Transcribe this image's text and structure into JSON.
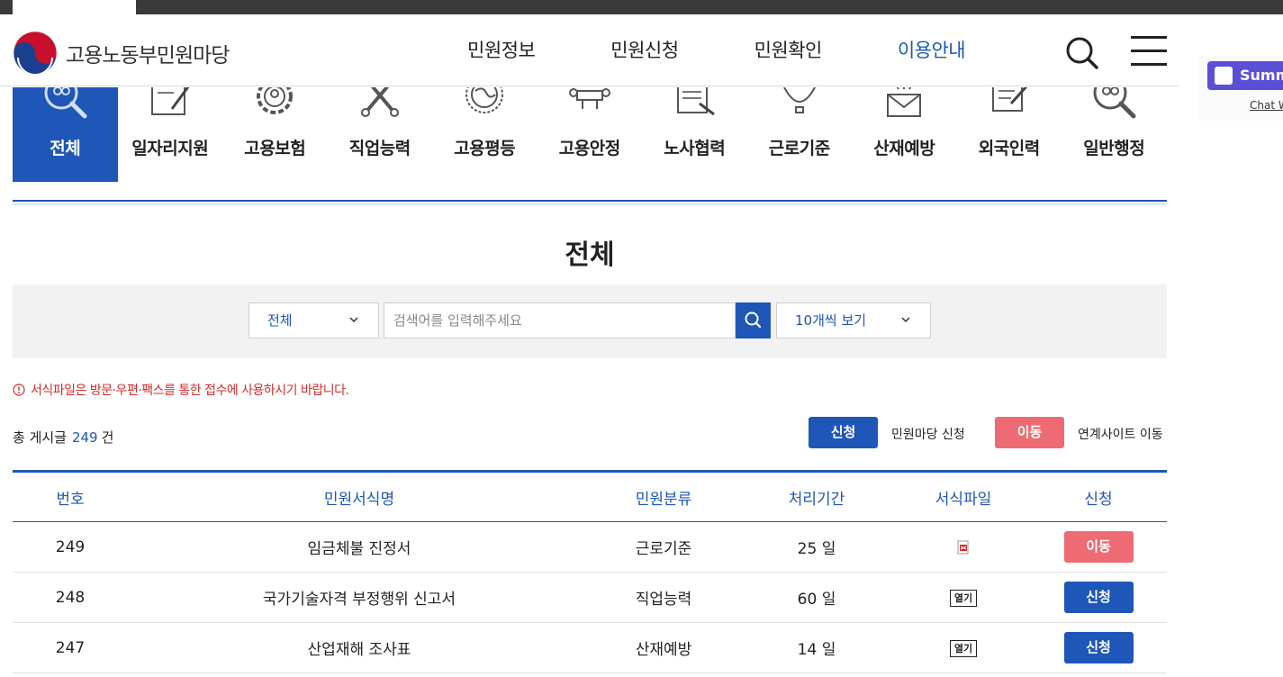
{
  "header": {
    "logo_text": "고용노동부민원마당",
    "nav": [
      {
        "label": "민원정보",
        "active": false
      },
      {
        "label": "민원신청",
        "active": false
      },
      {
        "label": "민원확인",
        "active": false
      },
      {
        "label": "이용안내",
        "active": true
      }
    ],
    "icons": {
      "search": "search-icon",
      "menu": "hamburger-menu-icon"
    }
  },
  "categories": [
    {
      "label": "전체",
      "icon": "magnifier-people-icon",
      "active": true
    },
    {
      "label": "일자리지원",
      "icon": "document-pen-icon",
      "active": false
    },
    {
      "label": "고용보험",
      "icon": "gear-people-icon",
      "active": false
    },
    {
      "label": "직업능력",
      "icon": "tools-icon",
      "active": false
    },
    {
      "label": "고용평등",
      "icon": "globe-icon",
      "active": false
    },
    {
      "label": "고용안정",
      "icon": "meeting-table-icon",
      "active": false
    },
    {
      "label": "노사협력",
      "icon": "contract-document-icon",
      "active": false
    },
    {
      "label": "근로기준",
      "icon": "scale-icon",
      "active": false
    },
    {
      "label": "산재예방",
      "icon": "envelope-icon",
      "active": false
    },
    {
      "label": "외국인력",
      "icon": "form-pencil-icon",
      "active": false
    },
    {
      "label": "일반행정",
      "icon": "magnifier-people-icon",
      "active": false
    }
  ],
  "page_title": "전체",
  "search": {
    "category_value": "전체",
    "placeholder": "검색어를 입력해주세요",
    "page_size_value": "10개씩 보기"
  },
  "notice": "서식파일은 방문·우편·팩스를 통한 접수에 사용하시기 바랍니다.",
  "count": {
    "prefix": "총 게시글",
    "value": "249",
    "suffix": "건"
  },
  "legend": {
    "apply_label": "신청",
    "apply_text": "민원마당 신청",
    "move_label": "이동",
    "move_text": "연계사이트 이동"
  },
  "table": {
    "headers": [
      "번호",
      "민원서식명",
      "민원분류",
      "처리기간",
      "서식파일",
      "신청"
    ],
    "rows": [
      {
        "no": "249",
        "name": "임금체불 진정서",
        "category": "근로기준",
        "period": "25 일",
        "file": "hwp-file-icon",
        "action": "이동",
        "action_type": "move"
      },
      {
        "no": "248",
        "name": "국가기술자격 부정행위 신고서",
        "category": "직업능력",
        "period": "60 일",
        "file_label": "열기",
        "action": "신청",
        "action_type": "apply"
      },
      {
        "no": "247",
        "name": "산업재해 조사표",
        "category": "산재예방",
        "period": "14 일",
        "file_label": "열기",
        "action": "신청",
        "action_type": "apply"
      }
    ]
  },
  "side_widget": {
    "button_label": "Summ",
    "link_label": "Chat W"
  },
  "colors": {
    "primary": "#1e57b8",
    "move": "#ef6b73",
    "notice": "#d22c2c",
    "summ": "#5b4fd8"
  }
}
